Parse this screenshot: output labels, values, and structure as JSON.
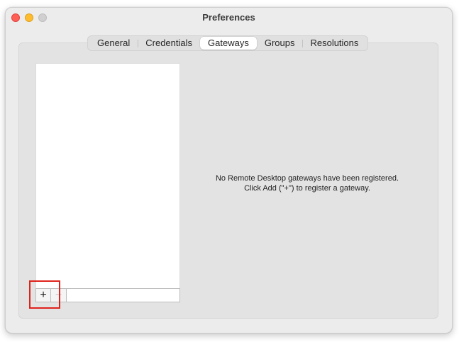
{
  "window": {
    "title": "Preferences"
  },
  "tabs": [
    {
      "label": "General",
      "active": false
    },
    {
      "label": "Credentials",
      "active": false
    },
    {
      "label": "Gateways",
      "active": true
    },
    {
      "label": "Groups",
      "active": false
    },
    {
      "label": "Resolutions",
      "active": false
    }
  ],
  "list_controls": {
    "add_label": "+",
    "remove_label": "−"
  },
  "empty_state": {
    "line1": "No Remote Desktop gateways have been registered.",
    "line2": "Click Add (\"+\") to register a gateway."
  },
  "colors": {
    "close": "#fe5f57",
    "minimize": "#febc2e",
    "maximize": "#d0d0d0",
    "highlight": "#e0221d"
  },
  "icons": {
    "close": "close-traffic-light-icon",
    "minimize": "minimize-traffic-light-icon",
    "maximize": "maximize-traffic-light-icon",
    "add": "plus-icon",
    "remove": "minus-icon"
  }
}
